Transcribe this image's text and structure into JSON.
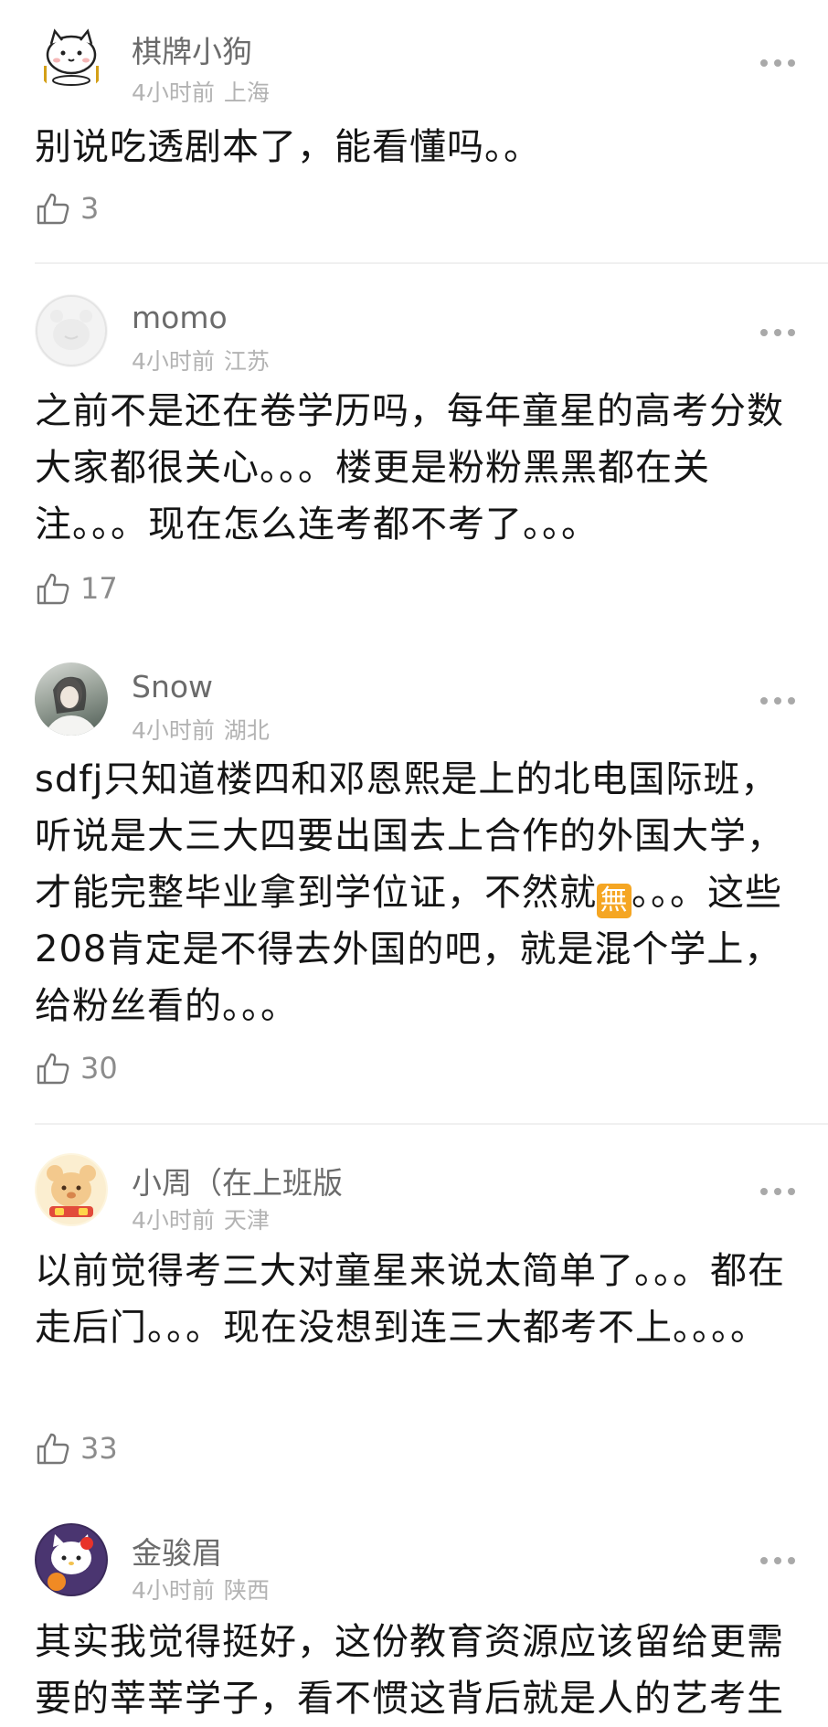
{
  "comments": [
    {
      "username": "棋牌小狗",
      "time": "4小时前",
      "location": "上海",
      "text": "别说吃透剧本了，能看懂吗。。",
      "likes": "3"
    },
    {
      "username": "momo",
      "time": "4小时前",
      "location": "江苏",
      "text": "之前不是还在卷学历吗，每年童星的高考分数大家都很关心。。。楼更是粉粉黑黑都在关注。。。现在怎么连考都不考了。。。",
      "likes": "17"
    },
    {
      "username": "Snow",
      "time": "4小时前",
      "location": "湖北",
      "text_before": "sdfj只知道楼四和邓恩熙是上的北电国际班，听说是大三大四要出国去上合作的外国大学，才能完整毕业拿到学位证，不然就",
      "emoji": "無",
      "text_after": "。。。这些208肯定是不得去外国的吧，就是混个学上，给粉丝看的。。。",
      "likes": "30"
    },
    {
      "username": "小周（在上班版",
      "time": "4小时前",
      "location": "天津",
      "text": "以前觉得考三大对童星来说太简单了。。。都在走后门。。。现在没想到连三大都考不上。。。。",
      "likes": "33"
    },
    {
      "username": "金骏眉",
      "time": "4小时前",
      "location": "陕西",
      "text": "其实我觉得挺好，这份教育资源应该留给更需要的莘莘学子，看不惯这背后就是人的艺考生",
      "likes": ""
    }
  ]
}
